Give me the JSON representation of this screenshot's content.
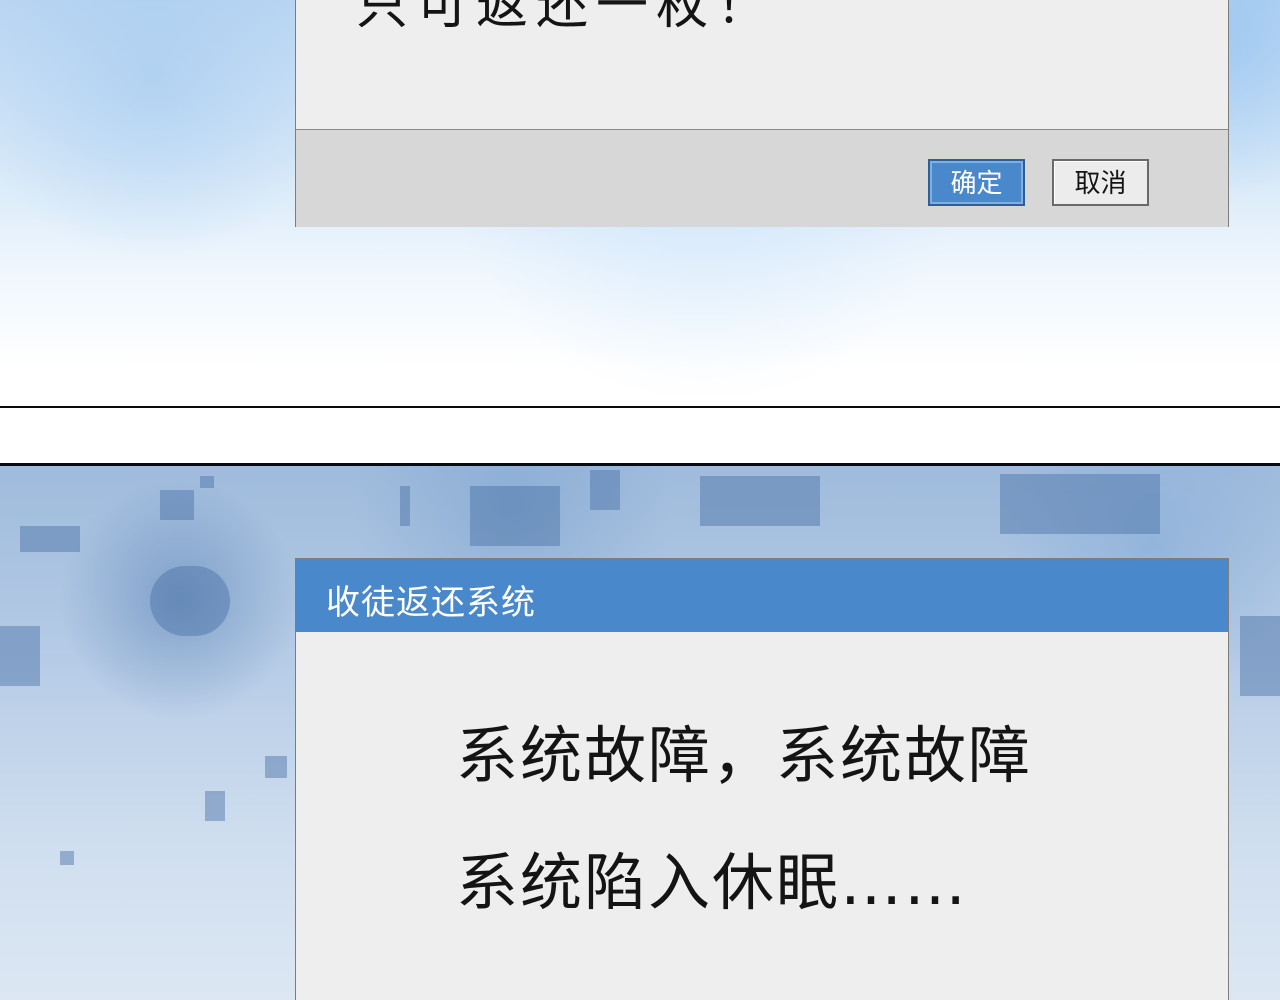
{
  "top_dialog": {
    "message": "只可返还一枚！",
    "ok_label": "确定",
    "cancel_label": "取消"
  },
  "bottom_dialog": {
    "title": "收徒返还系统",
    "line1": "系统故障，系统故障",
    "line2": "系统陷入休眠……"
  },
  "colors": {
    "accent": "#4a88cc",
    "dialog_body": "#eeeeee",
    "dialog_footer": "#d7d7d7",
    "text": "#141414"
  }
}
